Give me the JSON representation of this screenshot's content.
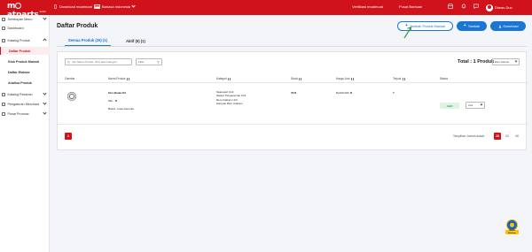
{
  "topbar": {
    "logo_text": "moatparts",
    "logo_sub": "Seller",
    "download_app": "Download moatmoat",
    "language": "Bahasa Indonesia",
    "verify": "Verifikasi moatmoat",
    "help": "Pusat Bantuan",
    "user": "Dimas Duo",
    "icons": [
      "phone-icon",
      "bell-icon",
      "chat-icon",
      "user-avatar"
    ],
    "accent": "#d0121b"
  },
  "sidebar": {
    "items": [
      {
        "label": "Semboyan Menu",
        "type": "parent"
      },
      {
        "label": "Dashboard",
        "type": "top"
      },
      {
        "label": "Katalog Produk",
        "type": "parent"
      },
      {
        "label": "Daftar Produk",
        "type": "child",
        "active": true
      },
      {
        "label": "Stok Produk Massal",
        "type": "child"
      },
      {
        "label": "Daftar Etalase",
        "type": "child"
      },
      {
        "label": "Analisa Produk",
        "type": "child"
      },
      {
        "label": "Katalog Pesanan",
        "type": "parent"
      },
      {
        "label": "Pengaturan Merchant",
        "type": "parent"
      },
      {
        "label": "Pusat Promosi",
        "type": "parent"
      }
    ]
  },
  "main": {
    "title": "Daftar Produk",
    "buttons": {
      "add_manual": "Tambah Produk Manual",
      "add": "Tambah",
      "download": "Download"
    },
    "tabs": [
      {
        "label": "Semua Produk (26) (1)",
        "active": true
      },
      {
        "label": "Aktif (9) (1)",
        "active": false
      }
    ],
    "search_placeholder": "Cari Nama Produk, SKU atau Kategori",
    "filter_label": "Filter",
    "total_label": "Total : 1 Produk",
    "sort_label": "Baru Masuk",
    "columns": [
      "Gambar",
      "Nama Produk",
      "Kategori",
      "Stock",
      "Harga Jual",
      "Terjual",
      "Status"
    ],
    "rows": [
      {
        "name": "Stor Brake Kit",
        "sku": "Sku :",
        "brand": "Brand : kuas Gemuke",
        "categories": [
          "Sparepart Unit",
          "Sistem Pengereman Unit",
          "Rem Cakram Unit",
          "Kampas Rem Cakram"
        ],
        "stock": "76",
        "price": "Rp100.000",
        "sold": "7",
        "status": "Aktif",
        "action": "Atur"
      }
    ],
    "page_current": "1",
    "page_size_label": "Tampilkan Jumlah data/d",
    "page_sizes": [
      {
        "value": "10",
        "active": true
      },
      {
        "value": "20",
        "active": false
      },
      {
        "value": "40",
        "active": false
      }
    ]
  },
  "fab": {
    "label": "Butuh Bantuan"
  }
}
